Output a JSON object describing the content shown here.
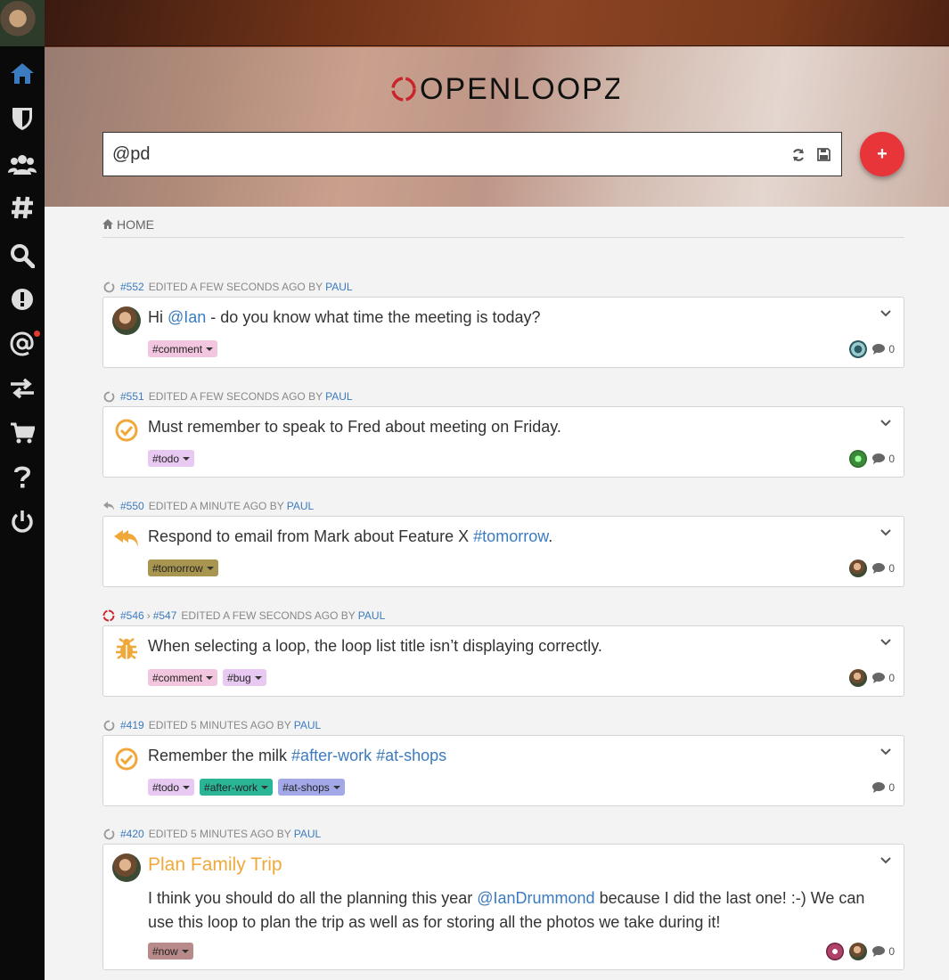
{
  "search": {
    "value": "@pd"
  },
  "breadcrumb": {
    "label": "HOME"
  },
  "add_button": {
    "label": "+"
  },
  "logo": {
    "text": "OPENLOOPZ"
  },
  "sidebar": {
    "items": [
      {
        "icon": "home-icon"
      },
      {
        "icon": "shield-icon"
      },
      {
        "icon": "users-icon"
      },
      {
        "icon": "hashtag-icon"
      },
      {
        "icon": "search-icon"
      },
      {
        "icon": "alert-icon"
      },
      {
        "icon": "at-icon"
      },
      {
        "icon": "exchange-icon"
      },
      {
        "icon": "cart-icon"
      },
      {
        "icon": "help-icon"
      },
      {
        "icon": "power-icon"
      }
    ]
  },
  "loops": [
    {
      "id": "#552",
      "edited": "EDITED A FEW SECONDS AGO BY",
      "by": "PAUL",
      "text_before": "Hi ",
      "mention": "@Ian",
      "text_after": " - do you know what time the meeting is today?",
      "tags": [
        {
          "label": "#comment",
          "color": "#f2c6de"
        }
      ],
      "comments": "0"
    },
    {
      "id": "#551",
      "edited": "EDITED A FEW SECONDS AGO BY",
      "by": "PAUL",
      "text": "Must remember to speak to Fred about meeting on Friday.",
      "tags": [
        {
          "label": "#todo",
          "color": "#e8c9f2"
        }
      ],
      "comments": "0"
    },
    {
      "id": "#550",
      "edited": "EDITED A MINUTE AGO BY",
      "by": "PAUL",
      "text_before": "Respond to email from Mark about Feature X ",
      "link": "#tomorrow",
      "text_after": ".",
      "tags": [
        {
          "label": "#tomorrow",
          "color": "#a89550"
        }
      ],
      "comments": "0"
    },
    {
      "id": "#546",
      "id2": "#547",
      "sep": "›",
      "edited": "EDITED A FEW SECONDS AGO BY",
      "by": "PAUL",
      "text": "When selecting a loop, the loop list title isn’t displaying correctly.",
      "tags": [
        {
          "label": "#comment",
          "color": "#f2c6de"
        },
        {
          "label": "#bug",
          "color": "#e8c9f2"
        }
      ],
      "comments": "0"
    },
    {
      "id": "#419",
      "edited": "EDITED 5 MINUTES AGO BY",
      "by": "PAUL",
      "text_before": "Remember the milk ",
      "link": "#after-work #at-shops",
      "tags": [
        {
          "label": "#todo",
          "color": "#e8c9f2"
        },
        {
          "label": "#after-work",
          "color": "#2bb597"
        },
        {
          "label": "#at-shops",
          "color": "#a3a8e8"
        }
      ],
      "comments": "0"
    },
    {
      "id": "#420",
      "edited": "EDITED 5 MINUTES AGO BY",
      "by": "PAUL",
      "title": "Plan Family Trip",
      "body_before": "I think you should do all the planning this year ",
      "body_mention": "@IanDrummond",
      "body_mid": " because I did the last one! :-) We can",
      "body_line2": "use this loop to plan the trip as well as for storing all the photos we take during it!",
      "tags": [
        {
          "label": "#now",
          "color": "#b88a8a"
        }
      ],
      "comments": "0"
    }
  ],
  "colors": {
    "accent": "#3b7bbf",
    "add_button": "#e8353a",
    "status_orange": "#f0a83a"
  }
}
